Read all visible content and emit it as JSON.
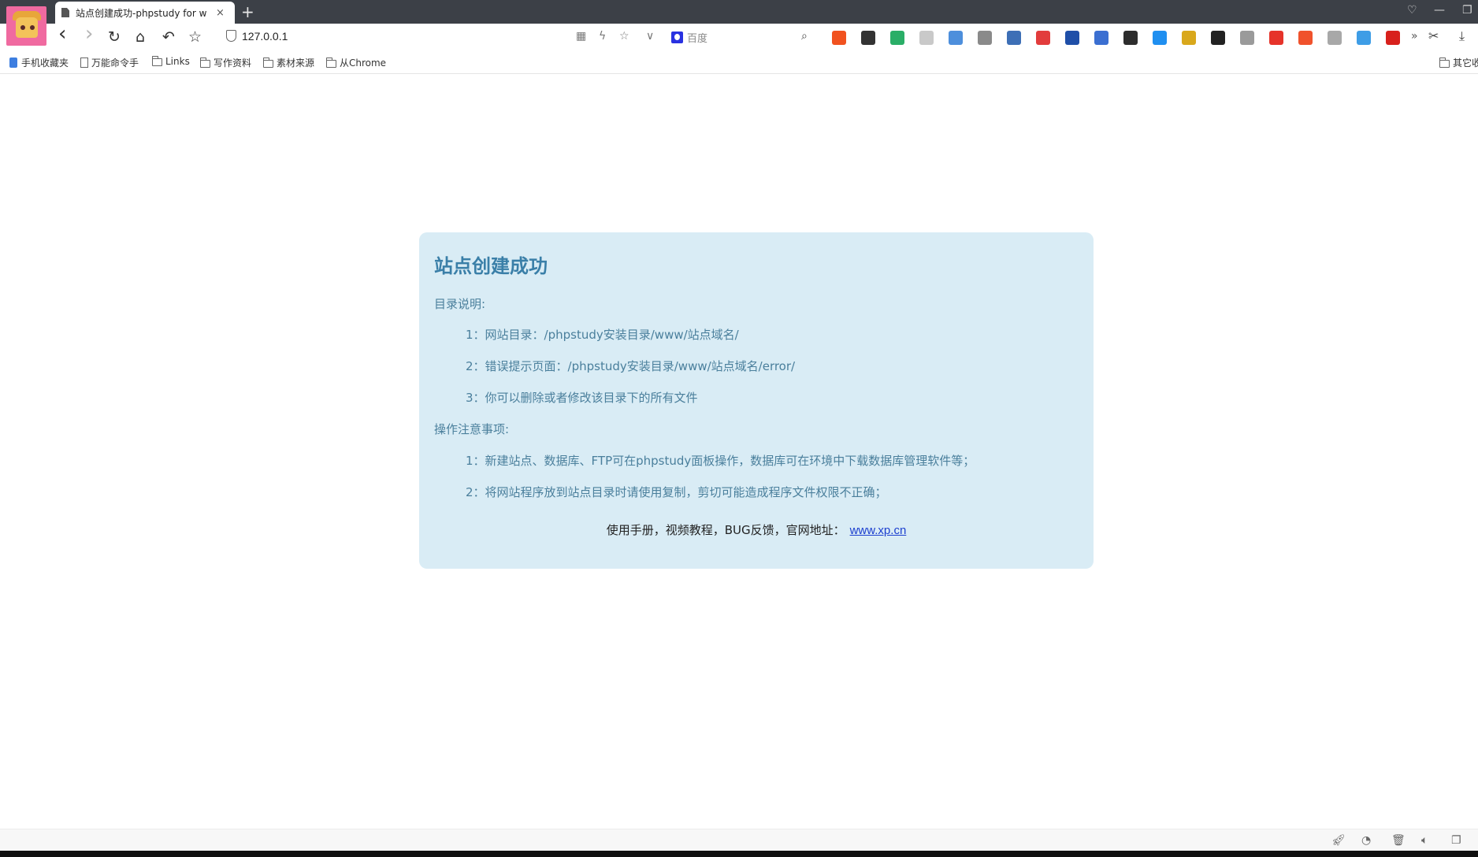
{
  "browser": {
    "tab": {
      "title": "站点创建成功-phpstudy for w",
      "close": "×"
    },
    "new_tab": "+",
    "window_controls": [
      "♡",
      "—",
      "❐"
    ],
    "nav": {
      "back": "‹",
      "forward": "›",
      "reload": "↻",
      "home": "⌂",
      "undo": "↶",
      "star": "☆"
    },
    "address": {
      "url": "127.0.0.1",
      "icons": [
        "▦",
        "ϟ",
        "☆",
        "∨"
      ]
    },
    "search": {
      "engine_icon": "baidu-icon",
      "placeholder": "百度",
      "go": "⌕"
    },
    "extension_colors": [
      "#f1521f",
      "#333333",
      "#2aae67",
      "#c9c9c9",
      "#4d8fdc",
      "#8a8a8a",
      "#3d6fb6",
      "#e23c3c",
      "#1f4fa8",
      "#3b6fd1",
      "#2d2d2d",
      "#1f8ff0",
      "#d9a81c",
      "#222222",
      "#9a9a9a",
      "#e6332a",
      "#f0522c",
      "#a8a8a8",
      "#3e9de6",
      "#d8211c"
    ],
    "more": "»",
    "bookmarks": [
      {
        "label": "手机收藏夹",
        "icon": "mobile"
      },
      {
        "label": "万能命令手",
        "icon": "page"
      },
      {
        "label": "Links",
        "icon": "folder"
      },
      {
        "label": "写作资料",
        "icon": "folder"
      },
      {
        "label": "素材来源",
        "icon": "folder"
      },
      {
        "label": "从Chrome",
        "icon": "folder"
      }
    ],
    "other_bookmarks": "其它收"
  },
  "page": {
    "title": "站点创建成功",
    "dir_heading": "目录说明:",
    "dir_items": [
      "1：网站目录：/phpstudy安装目录/www/站点域名/",
      "2：错误提示页面：/phpstudy安装目录/www/站点域名/error/",
      "3：你可以删除或者修改该目录下的所有文件"
    ],
    "ops_heading": "操作注意事项:",
    "ops_items": [
      "1：新建站点、数据库、FTP可在phpstudy面板操作，数据库可在环境中下载数据库管理软件等；",
      "2：将网站程序放到站点目录时请使用复制，剪切可能造成程序文件权限不正确；"
    ],
    "footer_text": "使用手册，视频教程，BUG反馈，官网地址：",
    "footer_link": "www.xp.cn"
  },
  "statusbar": {
    "icons": [
      "rocket-icon",
      "speed-icon",
      "trash-icon",
      "volume-icon",
      "window-icon"
    ]
  }
}
